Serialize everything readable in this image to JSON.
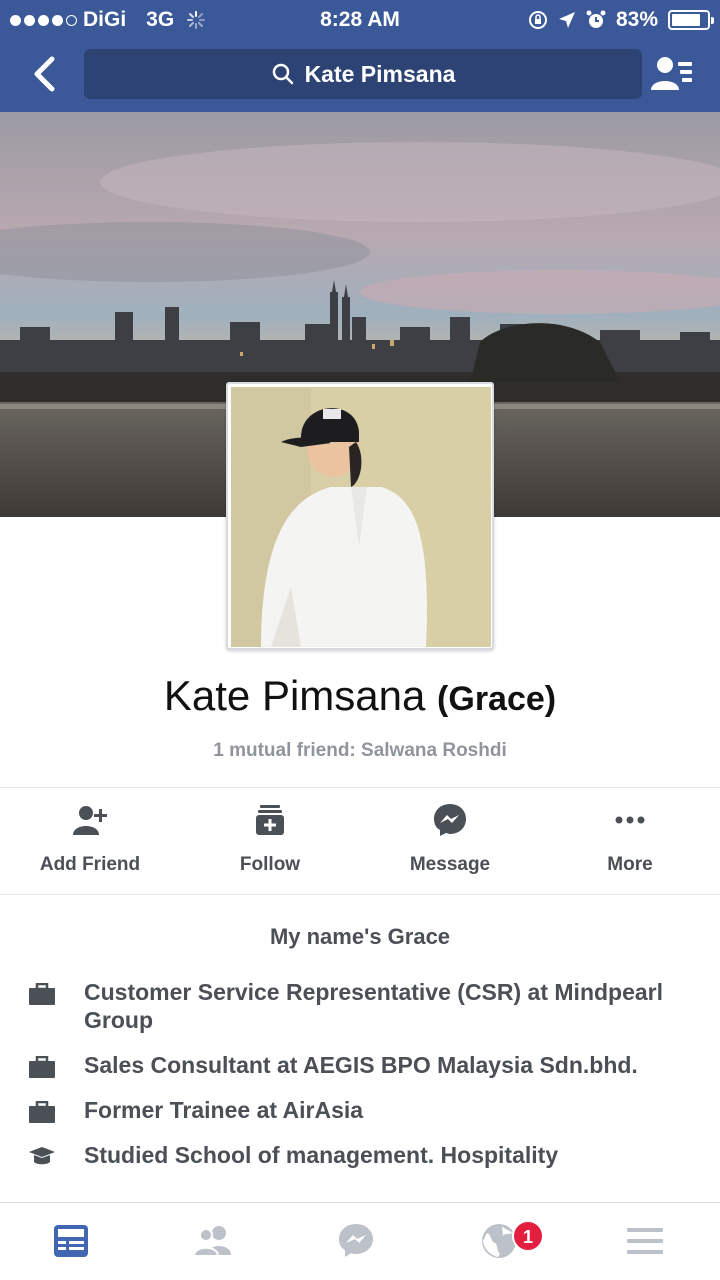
{
  "status_bar": {
    "carrier": "DiGi",
    "network": "3G",
    "time": "8:28 AM",
    "battery": "83%",
    "battery_level": 0.83
  },
  "nav": {
    "search_text": "Kate Pimsana"
  },
  "profile": {
    "name": "Kate Pimsana",
    "alt_name": "(Grace)",
    "mutual": "1 mutual friend: Salwana Roshdi"
  },
  "actions": [
    {
      "label": "Add Friend",
      "icon": "add-friend-icon"
    },
    {
      "label": "Follow",
      "icon": "follow-icon"
    },
    {
      "label": "Message",
      "icon": "messenger-icon"
    },
    {
      "label": "More",
      "icon": "more-icon"
    }
  ],
  "bio": "My name's Grace",
  "info": [
    {
      "icon": "briefcase-icon",
      "text": "Customer Service Representative (CSR) at Mindpearl Group"
    },
    {
      "icon": "briefcase-icon",
      "text": "Sales Consultant at AEGIS BPO Malaysia Sdn.bhd."
    },
    {
      "icon": "briefcase-icon",
      "text": "Former Trainee at AirAsia"
    },
    {
      "icon": "graduation-cap-icon",
      "text": "Studied School of management. Hospitality"
    }
  ],
  "tab_bar": {
    "notification_count": "1",
    "active_color": "#4267b2",
    "inactive_color": "#bdc1c9"
  }
}
